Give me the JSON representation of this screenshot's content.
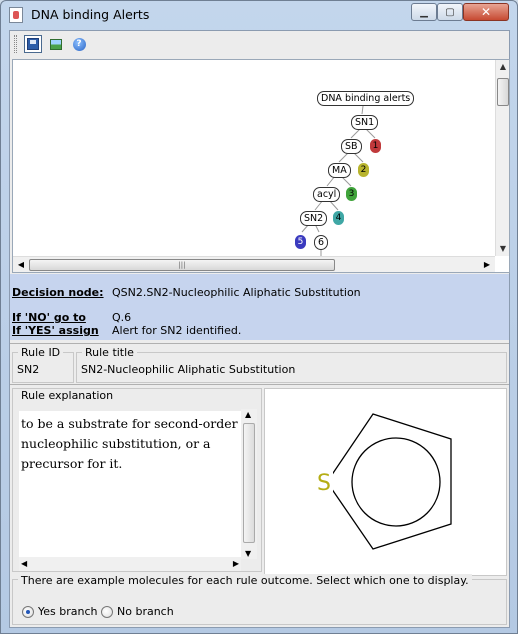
{
  "window": {
    "title": "DNA binding Alerts"
  },
  "tree": {
    "root": "DNA binding alerts",
    "nodes": [
      "SN1",
      "SB",
      "MA",
      "acyl",
      "SN2",
      "6"
    ],
    "leaves": [
      "1",
      "2",
      "3",
      "4",
      "5",
      "6"
    ],
    "leaf_colors": [
      "#c0393b",
      "#b8b42e",
      "#3fa33a",
      "#3fa7a5",
      "#3b3bbf",
      "#b248b8"
    ]
  },
  "decision": {
    "node_label": "Decision node:",
    "node_value": "QSN2.SN2-Nucleophilic Aliphatic Substitution",
    "no_label": "If 'NO' go to",
    "no_value": "Q.6",
    "yes_label": "If 'YES' assign",
    "yes_value": "Alert for SN2 identified."
  },
  "rule": {
    "id_header": "Rule ID",
    "id_value": "SN2",
    "title_header": "Rule title",
    "title_value": "SN2-Nucleophilic Aliphatic Substitution"
  },
  "explanation": {
    "header": "Rule explanation",
    "lines": [
      "to be a substrate for second-order",
      "nucleophilic substitution, or a",
      "precursor for it."
    ]
  },
  "molecule": {
    "atom_label": "S",
    "atom_color": "#b5ad14"
  },
  "examples": {
    "prompt": "There are example molecules for each rule outcome. Select which one to display.",
    "yes_label": "Yes branch",
    "no_label": "No branch",
    "selected": "yes"
  }
}
